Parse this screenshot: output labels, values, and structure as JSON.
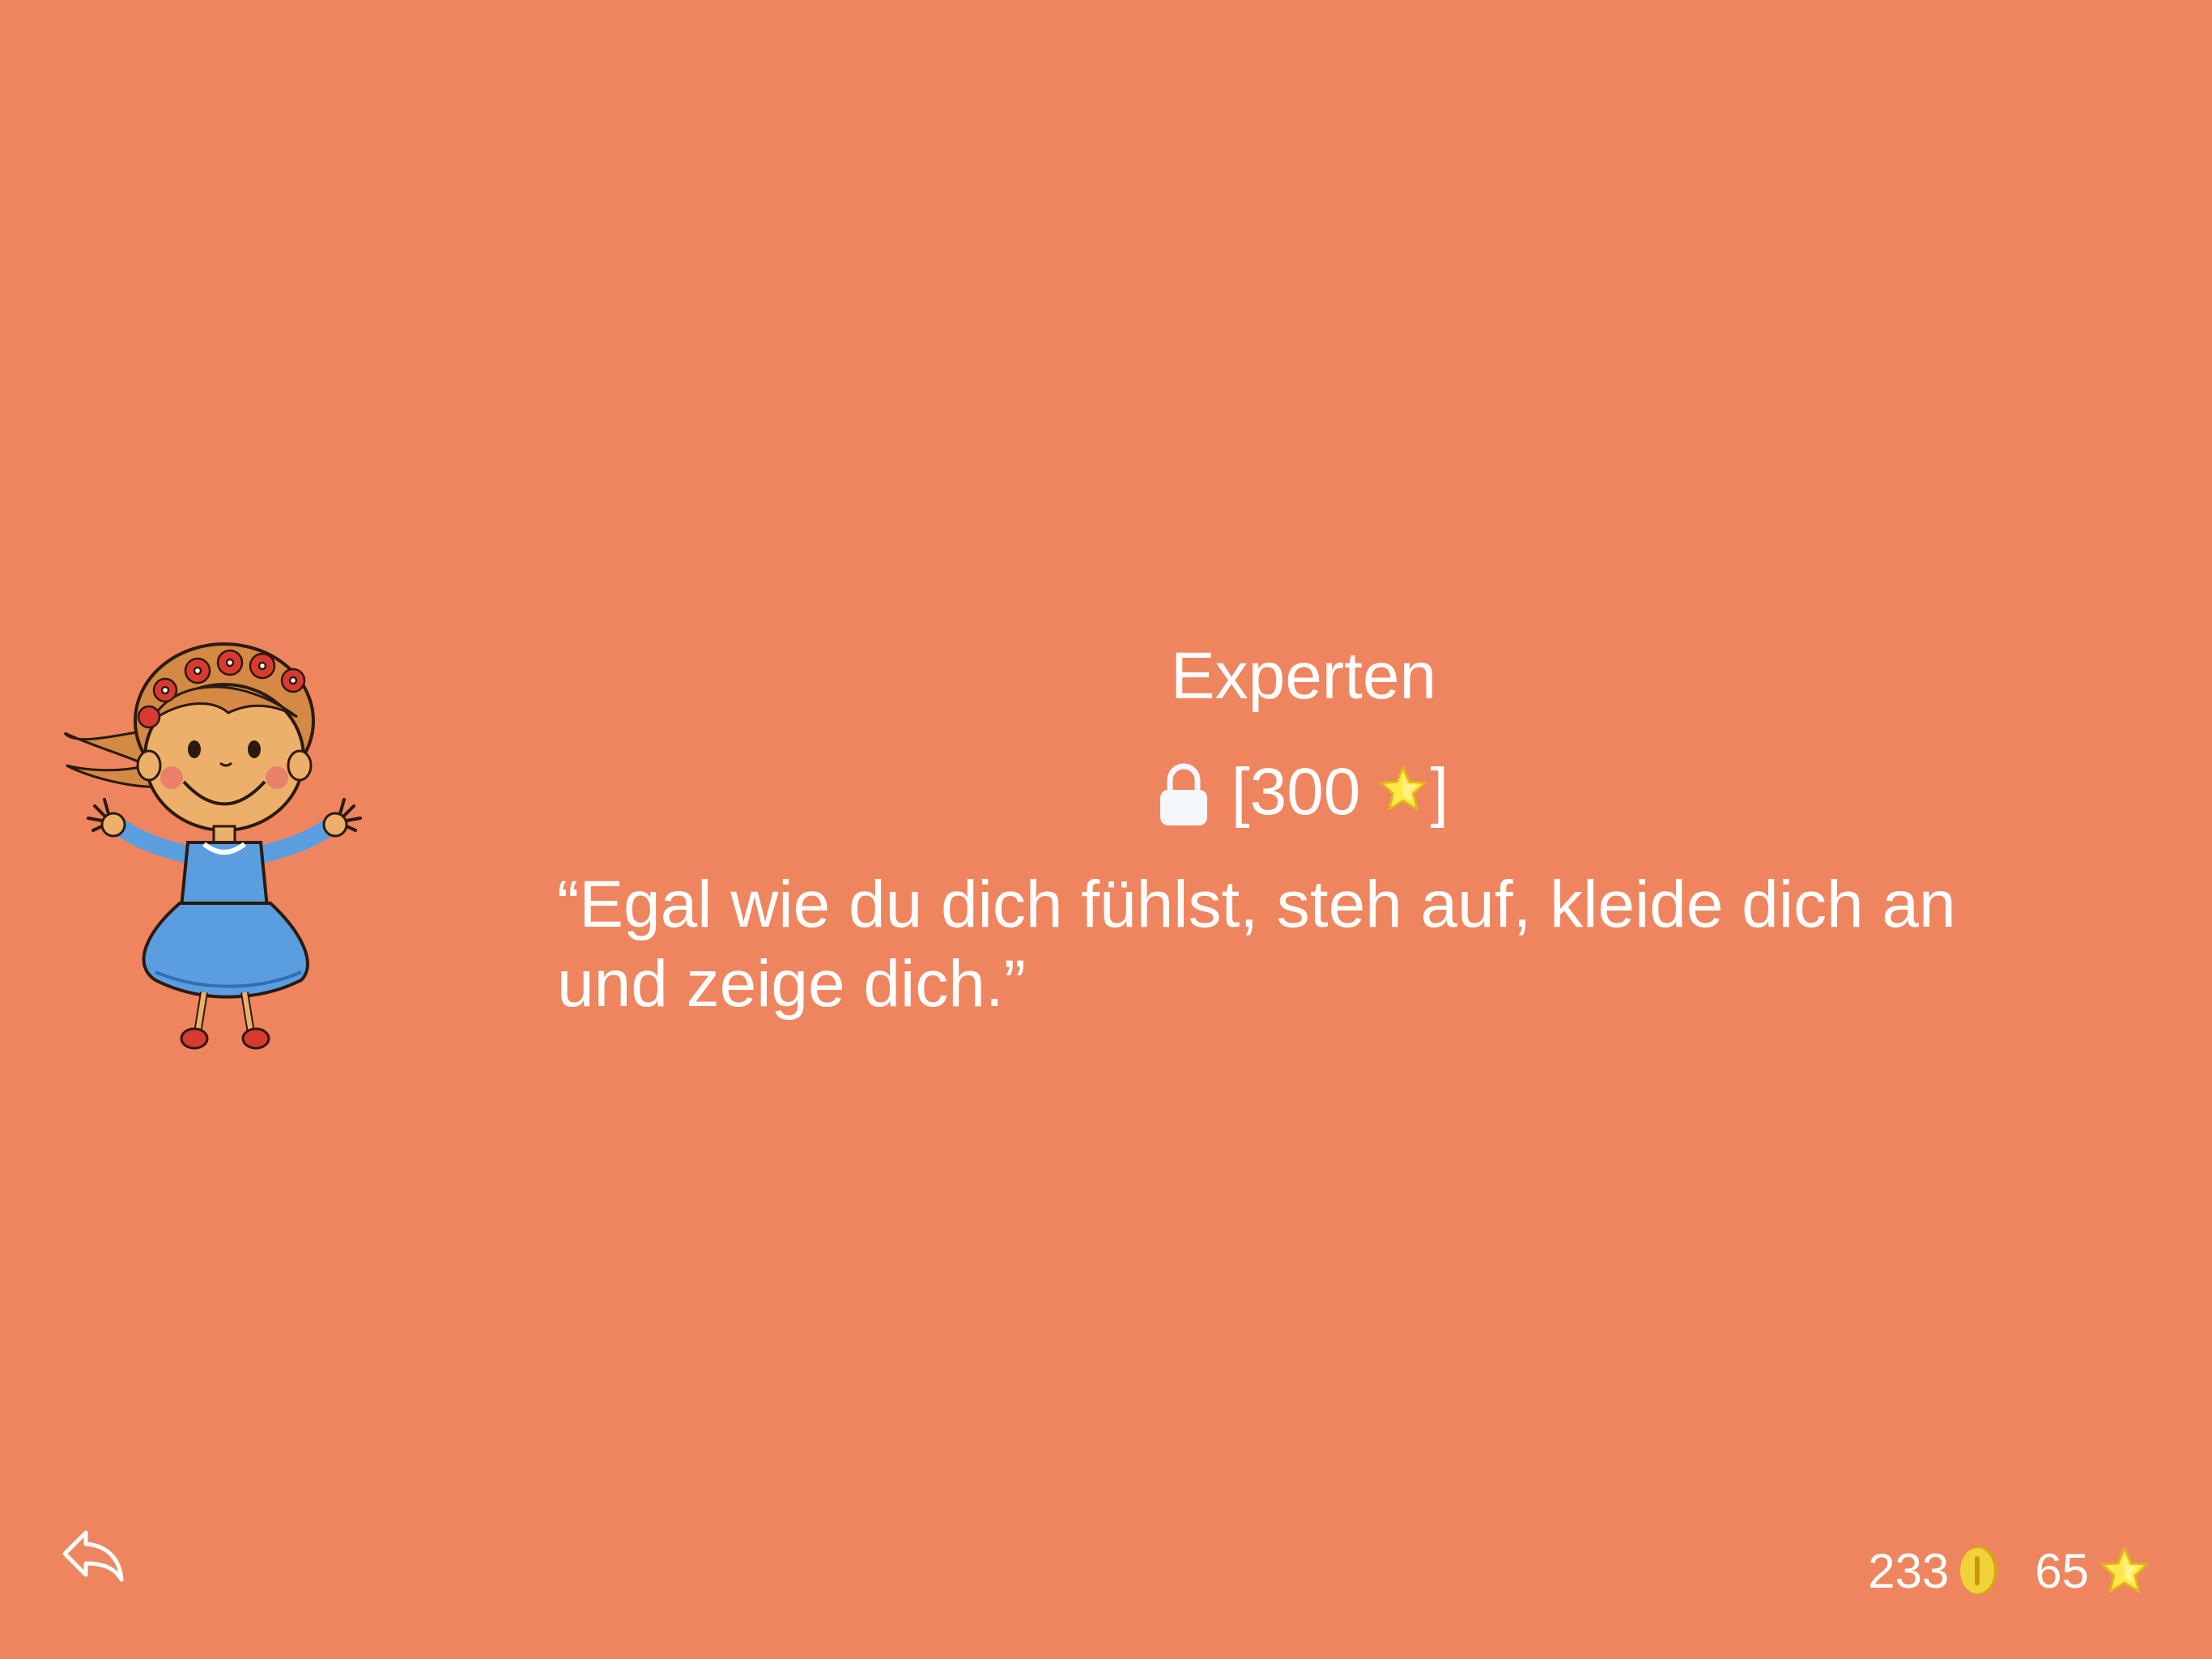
{
  "level": {
    "title": "Experten",
    "lock_open_bracket": "[",
    "required_stars": "300",
    "lock_close_bracket": "]"
  },
  "quote": {
    "text": "“Egal wie du dich fühlst, steh auf, kleide dich an und zeige dich.”"
  },
  "stats": {
    "coins": "233",
    "stars": "65"
  },
  "icons": {
    "back": "reply-arrow-icon",
    "lock": "lock-icon",
    "coin": "coin-icon",
    "star": "star-icon",
    "character": "girl-character-illustration"
  },
  "colors": {
    "background": "#EF855E",
    "text": "#FFFFFF",
    "star": "#FFE94A",
    "coin": "#E8C21A",
    "dress": "#5B9EE0"
  }
}
